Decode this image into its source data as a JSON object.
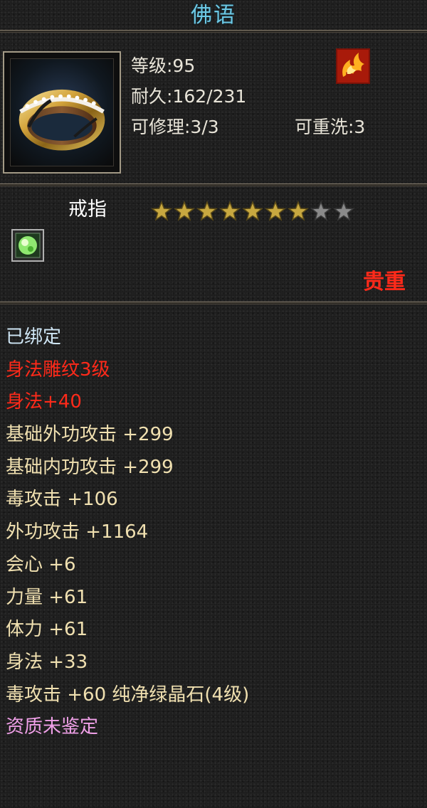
{
  "title": "佛语",
  "colors": {
    "title": "#6cc8e4",
    "stat": "#e8e4d8",
    "rarity": "#ff2a1a",
    "star_filled": "#c8a840",
    "star_empty": "#8a8a8a"
  },
  "item": {
    "level": "等级:95",
    "durability": "耐久:162/231",
    "repairable": "可修理:3/3",
    "rewashable": "可重洗:3",
    "type": "戒指",
    "stars_filled": 7,
    "stars_total": 9,
    "rarity": "贵重",
    "icon": "ring-icon",
    "class_icon": "flame-icon",
    "socket_icon": "green-gem-icon"
  },
  "attributes": [
    {
      "text": "已绑定",
      "color": "#cfe6f5"
    },
    {
      "text": "身法雕纹3级",
      "color": "#ff2a1a"
    },
    {
      "text": "身法+40",
      "color": "#ff2a1a"
    },
    {
      "text": "基础外功攻击  +299",
      "color": "#f0e0b0"
    },
    {
      "text": "基础内功攻击  +299",
      "color": "#f0e0b0"
    },
    {
      "text": "毒攻击  +106",
      "color": "#f0e0b0"
    },
    {
      "text": "外功攻击  +1164",
      "color": "#f0e0b0"
    },
    {
      "text": "会心  +6",
      "color": "#f0e0b0"
    },
    {
      "text": "力量  +61",
      "color": "#f0e0b0"
    },
    {
      "text": "体力  +61",
      "color": "#f0e0b0"
    },
    {
      "text": "身法  +33",
      "color": "#f0e0b0"
    },
    {
      "text": "毒攻击  +60  纯净绿晶石(4级)",
      "color": "#f0e0b0"
    },
    {
      "text": "资质未鉴定",
      "color": "#f0a0e8"
    }
  ]
}
